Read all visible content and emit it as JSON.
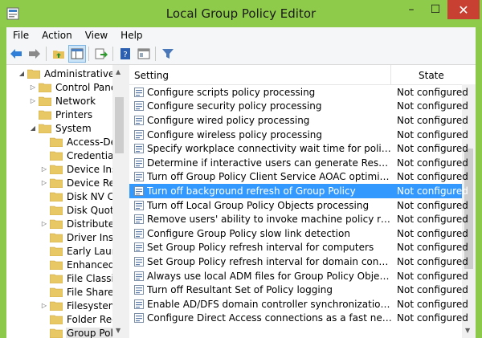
{
  "window": {
    "title": "Local Group Policy Editor",
    "minimize": "–",
    "maximize": "☐",
    "close": "✕"
  },
  "menu": [
    "File",
    "Action",
    "View",
    "Help"
  ],
  "toolbar": [
    "back-icon",
    "forward-icon",
    "up-folder-icon",
    "show-tree-icon",
    "export-icon",
    "help-icon",
    "properties-icon",
    "filter-icon"
  ],
  "tree": [
    {
      "label": "Administrative Ter",
      "indent": 0,
      "exp": "◢"
    },
    {
      "label": "Control Panel",
      "indent": 1,
      "exp": "▷"
    },
    {
      "label": "Network",
      "indent": 1,
      "exp": "▷"
    },
    {
      "label": "Printers",
      "indent": 1,
      "exp": ""
    },
    {
      "label": "System",
      "indent": 1,
      "exp": "◢"
    },
    {
      "label": "Access-Der",
      "indent": 2,
      "exp": ""
    },
    {
      "label": "Credentials",
      "indent": 2,
      "exp": ""
    },
    {
      "label": "Device Insta",
      "indent": 2,
      "exp": "▷"
    },
    {
      "label": "Device Red",
      "indent": 2,
      "exp": "▷"
    },
    {
      "label": "Disk NV Ca",
      "indent": 2,
      "exp": ""
    },
    {
      "label": "Disk Quota",
      "indent": 2,
      "exp": ""
    },
    {
      "label": "Distributed",
      "indent": 2,
      "exp": "▷"
    },
    {
      "label": "Driver Insta",
      "indent": 2,
      "exp": ""
    },
    {
      "label": "Early Launc",
      "indent": 2,
      "exp": ""
    },
    {
      "label": "Enhanced S",
      "indent": 2,
      "exp": ""
    },
    {
      "label": "File Classifi",
      "indent": 2,
      "exp": ""
    },
    {
      "label": "File Share S",
      "indent": 2,
      "exp": ""
    },
    {
      "label": "Filesystem",
      "indent": 2,
      "exp": "▷"
    },
    {
      "label": "Folder Redi",
      "indent": 2,
      "exp": ""
    },
    {
      "label": "Group Polic",
      "indent": 2,
      "exp": ""
    }
  ],
  "list": {
    "headers": {
      "setting": "Setting",
      "state": "State"
    },
    "rows": [
      {
        "name": "Configure scripts policy processing",
        "state": "Not configured"
      },
      {
        "name": "Configure security policy processing",
        "state": "Not configured"
      },
      {
        "name": "Configure wired policy processing",
        "state": "Not configured"
      },
      {
        "name": "Configure wireless policy processing",
        "state": "Not configured"
      },
      {
        "name": "Specify workplace connectivity wait time for policy processi...",
        "state": "Not configured"
      },
      {
        "name": "Determine if interactive users can generate Resultant Set of ...",
        "state": "Not configured"
      },
      {
        "name": "Turn off Group Policy Client Service AOAC optimization",
        "state": "Not configured"
      },
      {
        "name": "Turn off background refresh of Group Policy",
        "state": "Not configured",
        "selected": true
      },
      {
        "name": "Turn off Local Group Policy Objects processing",
        "state": "Not configured"
      },
      {
        "name": "Remove users' ability to invoke machine policy refresh",
        "state": "Not configured"
      },
      {
        "name": "Configure Group Policy slow link detection",
        "state": "Not configured"
      },
      {
        "name": "Set Group Policy refresh interval for computers",
        "state": "Not configured"
      },
      {
        "name": "Set Group Policy refresh interval for domain controllers",
        "state": "Not configured"
      },
      {
        "name": "Always use local ADM files for Group Policy Object Editor",
        "state": "Not configured"
      },
      {
        "name": "Turn off Resultant Set of Policy logging",
        "state": "Not configured"
      },
      {
        "name": "Enable AD/DFS domain controller synchronization during p...",
        "state": "Not configured"
      },
      {
        "name": "Configure Direct Access connections as a fast network conn...",
        "state": "Not configured"
      }
    ]
  },
  "colors": {
    "accent": "#8fcb4b",
    "selection": "#3399ff",
    "close": "#c84031"
  }
}
